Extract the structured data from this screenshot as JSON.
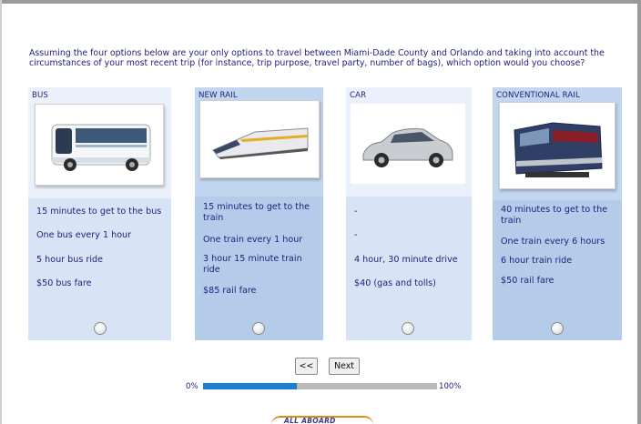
{
  "question": "Assuming the four options below are your only options to travel between Miami-Dade County and Orlando and taking into account the circumstances of your most recent trip (for instance, trip purpose, travel party, number of bags), which option would you choose?",
  "options": [
    {
      "title": "BUS",
      "image": "bus-image",
      "attributes": [
        "15 minutes to get to the bus",
        "One bus every 1 hour",
        "5 hour bus ride",
        "$50 bus fare"
      ]
    },
    {
      "title": "NEW RAIL",
      "image": "high-speed-train-image",
      "attributes": [
        "15 minutes to get to the train",
        "One train every 1 hour",
        "3 hour 15 minute train ride",
        "$85 rail fare"
      ]
    },
    {
      "title": "CAR",
      "image": "car-image",
      "attributes": [
        "-",
        "-",
        "4 hour, 30 minute drive",
        "$40 (gas and tolls)"
      ]
    },
    {
      "title": "CONVENTIONAL RAIL",
      "image": "locomotive-image",
      "attributes": [
        "40 minutes to get to the train",
        "One train every 6 hours",
        "6 hour train ride",
        "$50 rail fare"
      ]
    }
  ],
  "nav": {
    "back_label": "<<",
    "next_label": "Next"
  },
  "progress": {
    "start_label": "0%",
    "end_label": "100%",
    "value_percent": 40
  },
  "logo": {
    "text": "ALL ABOARD FLORIDA"
  },
  "colors": {
    "accent": "#1b7fd1",
    "text": "#1f1f7a",
    "col_light": "#eaf1fa",
    "col_dark": "#c2d6ef"
  }
}
